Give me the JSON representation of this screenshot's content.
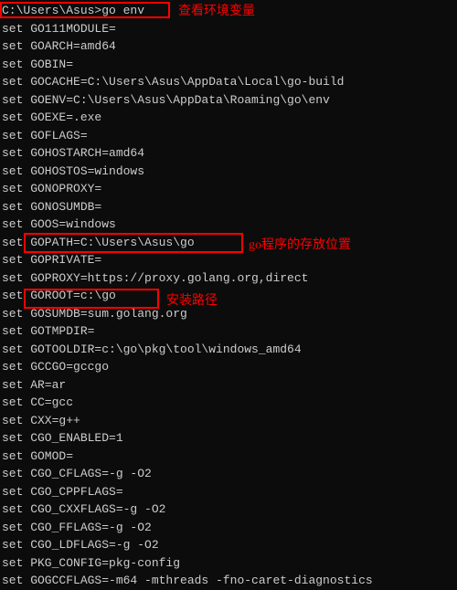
{
  "prompt": "C:\\Users\\Asus>go env",
  "annotations": {
    "command": "查看环境变量",
    "gopath": "go程序的存放位置",
    "goroot": "安装路径"
  },
  "lines": [
    "set GO111MODULE=",
    "set GOARCH=amd64",
    "set GOBIN=",
    "set GOCACHE=C:\\Users\\Asus\\AppData\\Local\\go-build",
    "set GOENV=C:\\Users\\Asus\\AppData\\Roaming\\go\\env",
    "set GOEXE=.exe",
    "set GOFLAGS=",
    "set GOHOSTARCH=amd64",
    "set GOHOSTOS=windows",
    "set GONOPROXY=",
    "set GONOSUMDB=",
    "set GOOS=windows",
    "set GOPATH=C:\\Users\\Asus\\go",
    "set GOPRIVATE=",
    "set GOPROXY=https://proxy.golang.org,direct",
    "set GOROOT=c:\\go",
    "set GOSUMDB=sum.golang.org",
    "set GOTMPDIR=",
    "set GOTOOLDIR=c:\\go\\pkg\\tool\\windows_amd64",
    "set GCCGO=gccgo",
    "set AR=ar",
    "set CC=gcc",
    "set CXX=g++",
    "set CGO_ENABLED=1",
    "set GOMOD=",
    "set CGO_CFLAGS=-g -O2",
    "set CGO_CPPFLAGS=",
    "set CGO_CXXFLAGS=-g -O2",
    "set CGO_FFLAGS=-g -O2",
    "set CGO_LDFLAGS=-g -O2",
    "set PKG_CONFIG=pkg-config",
    "set GOGCCFLAGS=-m64 -mthreads -fno-caret-diagnostics"
  ]
}
